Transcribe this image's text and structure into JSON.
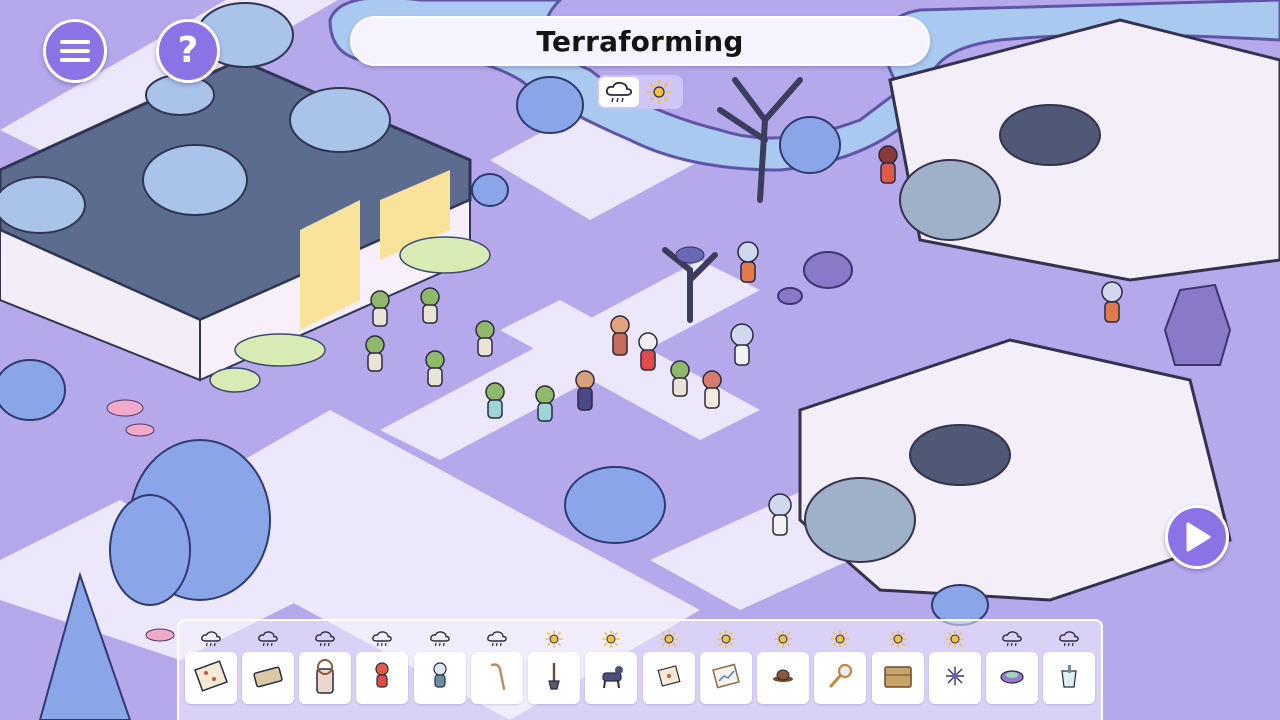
{
  "header": {
    "title": "Terraforming"
  },
  "buttons": {
    "menu": "menu",
    "help": "help",
    "next": "next"
  },
  "weather_toggle": {
    "options": [
      "cloudy",
      "sunny"
    ],
    "selected": "cloudy"
  },
  "tray": {
    "items": [
      {
        "weather": "cloudy",
        "icon": "chair-pattern-icon"
      },
      {
        "weather": "cloudy",
        "icon": "tray-icon"
      },
      {
        "weather": "cloudy",
        "icon": "ship-wheel-door-icon"
      },
      {
        "weather": "cloudy",
        "icon": "red-astronaut-icon"
      },
      {
        "weather": "cloudy",
        "icon": "blue-astronaut-icon"
      },
      {
        "weather": "cloudy",
        "icon": "cane-icon"
      },
      {
        "weather": "sunny",
        "icon": "shovel-icon"
      },
      {
        "weather": "sunny",
        "icon": "robot-dog-icon"
      },
      {
        "weather": "sunny",
        "icon": "note-card-icon"
      },
      {
        "weather": "sunny",
        "icon": "chart-frame-icon"
      },
      {
        "weather": "sunny",
        "icon": "hat-icon"
      },
      {
        "weather": "sunny",
        "icon": "magnifier-icon"
      },
      {
        "weather": "sunny",
        "icon": "basket-icon"
      },
      {
        "weather": "sunny",
        "icon": "sea-urchin-icon"
      },
      {
        "weather": "cloudy",
        "icon": "bowl-icon"
      },
      {
        "weather": "cloudy",
        "icon": "cup-icon"
      }
    ]
  },
  "colors": {
    "ground": "#b5a9ec",
    "path": "#ece7fa",
    "button": "#8b73e6",
    "foliage": "#8aa6e8",
    "spaceship": "#f4eef8"
  }
}
